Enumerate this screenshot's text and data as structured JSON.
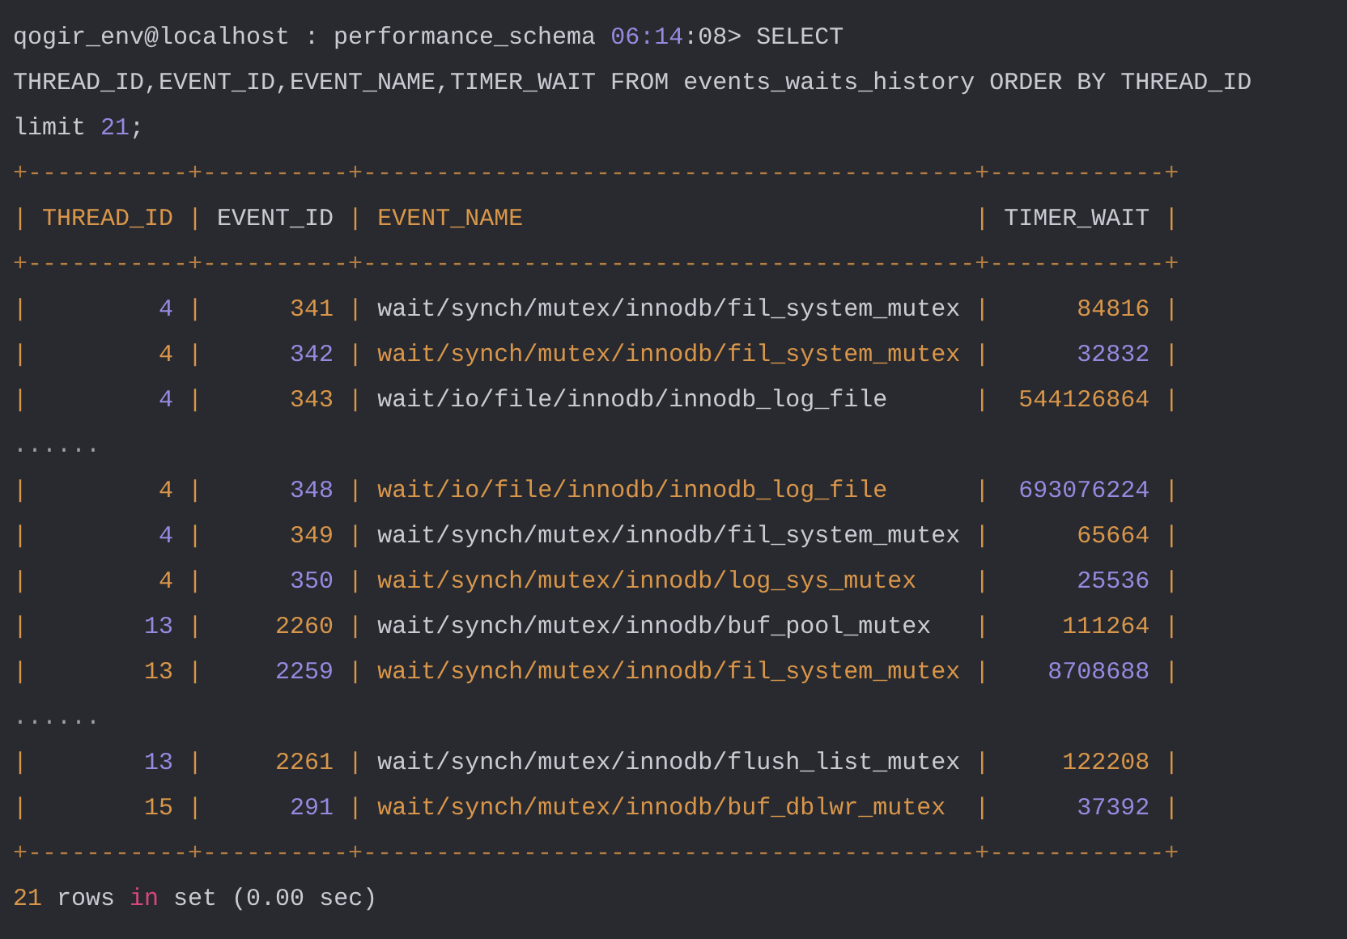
{
  "command_lines": [
    [
      {
        "text": "qogir_env@localhost : performance_schema ",
        "kind": "plain"
      },
      {
        "text": "06:14",
        "kind": "number"
      },
      {
        "text": ":08> SELECT",
        "kind": "plain"
      }
    ],
    [
      {
        "text": "THREAD_ID,EVENT_ID,EVENT_NAME,TIMER_WAIT FROM events_waits_history ORDER BY THREAD_ID",
        "kind": "plain"
      }
    ],
    [
      {
        "text": "limit ",
        "kind": "plain"
      },
      {
        "text": "21",
        "kind": "number"
      },
      {
        "text": ";",
        "kind": "plain"
      }
    ]
  ],
  "table": {
    "border_top": "+-----------+----------+------------------------------------------+------------+",
    "column_separator": "|",
    "columns": [
      {
        "label": "THREAD_ID",
        "kind": "accent"
      },
      {
        "label": "EVENT_ID",
        "kind": "plain"
      },
      {
        "label": "EVENT_NAME",
        "kind": "accent"
      },
      {
        "label": "TIMER_WAIT",
        "kind": "plain"
      }
    ],
    "border_header": "+-----------+----------+------------------------------------------+------------+",
    "rows": [
      {
        "kind": "plain",
        "cells": [
          "4",
          "341",
          "wait/synch/mutex/innodb/fil_system_mutex",
          "84816"
        ]
      },
      {
        "kind": "accent",
        "cells": [
          "4",
          "342",
          "wait/synch/mutex/innodb/fil_system_mutex",
          "32832"
        ]
      },
      {
        "kind": "plain",
        "cells": [
          "4",
          "343",
          "wait/io/file/innodb/innodb_log_file",
          "544126864"
        ]
      },
      {
        "kind": "gap",
        "text": "......"
      },
      {
        "kind": "accent",
        "cells": [
          "4",
          "348",
          "wait/io/file/innodb/innodb_log_file",
          "693076224"
        ]
      },
      {
        "kind": "plain",
        "cells": [
          "4",
          "349",
          "wait/synch/mutex/innodb/fil_system_mutex",
          "65664"
        ]
      },
      {
        "kind": "accent",
        "cells": [
          "4",
          "350",
          "wait/synch/mutex/innodb/log_sys_mutex",
          "25536"
        ]
      },
      {
        "kind": "plain",
        "cells": [
          "13",
          "2260",
          "wait/synch/mutex/innodb/buf_pool_mutex",
          "111264"
        ]
      },
      {
        "kind": "accent",
        "cells": [
          "13",
          "2259",
          "wait/synch/mutex/innodb/fil_system_mutex",
          "8708688"
        ]
      },
      {
        "kind": "gap",
        "text": "......"
      },
      {
        "kind": "plain",
        "cells": [
          "13",
          "2261",
          "wait/synch/mutex/innodb/flush_list_mutex",
          "122208"
        ]
      },
      {
        "kind": "accent",
        "cells": [
          "15",
          "291",
          "wait/synch/mutex/innodb/buf_dblwr_mutex",
          "37392"
        ]
      }
    ],
    "border_bottom": "+-----------+----------+------------------------------------------+------------+"
  },
  "result_line": [
    {
      "text": "21",
      "kind": "accent"
    },
    {
      "text": " rows ",
      "kind": "plain"
    },
    {
      "text": "in",
      "kind": "keyword"
    },
    {
      "text": " set (0.00 sec)",
      "kind": "plain"
    }
  ]
}
